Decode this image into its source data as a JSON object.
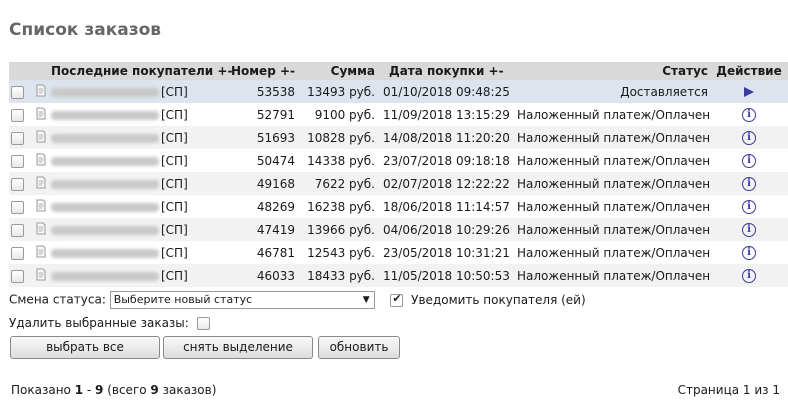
{
  "page": {
    "title": "Список заказов"
  },
  "table": {
    "headers": {
      "buyers": "Последние покупатели +-",
      "number": "Номер +-",
      "sum": "Сумма",
      "date": "Дата покупки +-",
      "status": "Статус",
      "action": "Действие"
    },
    "rows": [
      {
        "buyer_tag": "[СП]",
        "number": "53538",
        "sum": "13493 руб.",
        "date": "01/10/2018 09:48:25",
        "status": "Доставляется",
        "action_icon": "play-icon"
      },
      {
        "buyer_tag": "[СП]",
        "number": "52791",
        "sum": "9100 руб.",
        "date": "11/09/2018 13:15:29",
        "status": "Наложенный платеж/Оплачен",
        "action_icon": "info-icon"
      },
      {
        "buyer_tag": "[СП]",
        "number": "51693",
        "sum": "10828 руб.",
        "date": "14/08/2018 11:20:20",
        "status": "Наложенный платеж/Оплачен",
        "action_icon": "info-icon"
      },
      {
        "buyer_tag": "[СП]",
        "number": "50474",
        "sum": "14338 руб.",
        "date": "23/07/2018 09:18:18",
        "status": "Наложенный платеж/Оплачен",
        "action_icon": "info-icon"
      },
      {
        "buyer_tag": "[СП]",
        "number": "49168",
        "sum": "7622 руб.",
        "date": "02/07/2018 12:22:22",
        "status": "Наложенный платеж/Оплачен",
        "action_icon": "info-icon"
      },
      {
        "buyer_tag": "[СП]",
        "number": "48269",
        "sum": "16238 руб.",
        "date": "18/06/2018 11:14:57",
        "status": "Наложенный платеж/Оплачен",
        "action_icon": "info-icon"
      },
      {
        "buyer_tag": "[СП]",
        "number": "47419",
        "sum": "13966 руб.",
        "date": "04/06/2018 10:29:26",
        "status": "Наложенный платеж/Оплачен",
        "action_icon": "info-icon"
      },
      {
        "buyer_tag": "[СП]",
        "number": "46781",
        "sum": "12543 руб.",
        "date": "23/05/2018 10:31:21",
        "status": "Наложенный платеж/Оплачен",
        "action_icon": "info-icon"
      },
      {
        "buyer_tag": "[СП]",
        "number": "46033",
        "sum": "18433 руб.",
        "date": "11/05/2018 10:50:53",
        "status": "Наложенный платеж/Оплачен",
        "action_icon": "info-icon"
      }
    ]
  },
  "controls": {
    "status_change_label": "Смена статуса:",
    "status_select_value": "Выберите новый статус",
    "notify_label": "Уведомить покупателя (ей)",
    "notify_checked": true,
    "delete_label": "Удалить выбранные заказы:",
    "delete_checked": false,
    "select_all_label": "выбрать все",
    "deselect_label": "снять выделение",
    "refresh_label": "обновить"
  },
  "footer": {
    "shown_prefix": "Показано ",
    "shown_from": "1",
    "shown_sep": " - ",
    "shown_to": "9",
    "shown_total_prefix": " (всего ",
    "shown_total": "9",
    "shown_total_suffix": " заказов)",
    "page_info": "Страница 1 из 1"
  }
}
